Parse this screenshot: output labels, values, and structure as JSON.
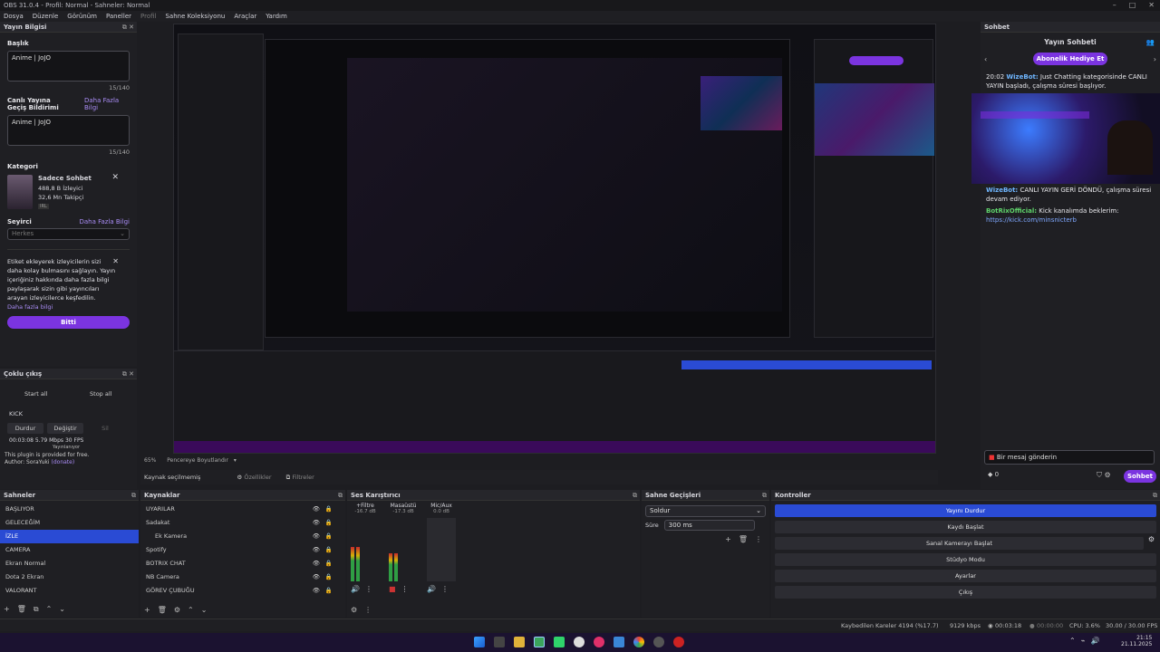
{
  "window": {
    "title": "OBS 31.0.4 - Profil: Normal - Sahneler: Normal",
    "controls": [
      "–",
      "□",
      "✕"
    ]
  },
  "menu": {
    "items": [
      "Dosya",
      "Düzenle",
      "Görünüm",
      "Paneller",
      "Profil",
      "Sahne Koleksiyonu",
      "Araçlar",
      "Yardım"
    ]
  },
  "stream_info": {
    "dock_title": "Yayın Bilgisi",
    "title_label": "Başlık",
    "title_value": "Anime | JoJO",
    "title_count": "15/140",
    "notif_label": "Canlı Yayına Geçiş Bildirimi",
    "more_info": "Daha Fazla Bilgi",
    "notif_value": "Anime | JoJO",
    "notif_count": "15/140",
    "category_label": "Kategori",
    "category_name": "Sadece Sohbet",
    "category_viewers": "488,8 B İzleyici",
    "category_followers": "32,6 Mn Takipçi",
    "category_tag": "IRL",
    "audience_label": "Seyirci",
    "audience_more": "Daha Fazla Bilgi",
    "audience_value": "Herkes",
    "tags_text": "Etiket ekleyerek izleyicilerin sizi daha kolay bulmasını sağlayın. Yayın içeriğiniz hakkında daha fazla bilgi paylaşarak sizin gibi yayıncıları arayan izleyicilerce keşfedilin.",
    "tags_more": "Daha fazla bilgi",
    "done_button": "Bitti"
  },
  "multi_stream": {
    "dock_title": "Çoklu çıkış",
    "start_all": "Start all",
    "stop_all": "Stop all",
    "target": "KICK",
    "stop": "Durdur",
    "edit": "Değiştir",
    "delete": "Sil",
    "stats": "00:03:08  5.79 Mbps  30 FPS",
    "status": "Yayınlanıyor",
    "plugin_note": "This plugin is provided for free.",
    "author": "Author: SoraYuki",
    "author_link": "(donate)"
  },
  "chat": {
    "dock_title": "Sohbet",
    "header": "Yayın Sohbeti",
    "gift_button": "Abonelik Hediye Et",
    "messages": [
      {
        "time": "20:02",
        "name": "WizeBot:",
        "text": "Just Chatting kategorisinde CANLI YAYIN başladı, çalışma süresi başlıyor."
      },
      {
        "time": "",
        "name": "",
        "text": "süresi devam ediyor."
      },
      {
        "time": "",
        "name": "WizeBot:",
        "text": "CANLI YAYIN GERİ DÖNDÜ, çalışma süresi devam ediyor."
      },
      {
        "time": "",
        "name": "BotRixOfficial:",
        "text": "Kick kanalımda beklerim:"
      },
      {
        "time": "",
        "name": "",
        "text": "https://kick.com/minsnicterb"
      }
    ],
    "input_placeholder": "Bir mesaj gönderin",
    "points": "0",
    "send_button": "Sohbet"
  },
  "preview_bar": {
    "zoom": "65%",
    "fit": "Pencereye Boyutlandır"
  },
  "source_bar": {
    "no_source": "Kaynak seçilmemiş",
    "properties": "Özellikler",
    "filters": "Filtreler"
  },
  "scenes": {
    "dock_title": "Sahneler",
    "items": [
      "BAŞLIYOR",
      "GELECEĞİM",
      "İZLE",
      "CAMERA",
      "Ekran Normal",
      "Dota 2 Ekran",
      "VALORANT"
    ],
    "selected_index": 2
  },
  "sources": {
    "dock_title": "Kaynaklar",
    "items": [
      "UYARILAR",
      "Sadakat",
      "Ek Kamera",
      "Spotify",
      "BOTRIX CHAT",
      "NB Camera",
      "GÖREV ÇUBUĞU"
    ]
  },
  "mixer": {
    "dock_title": "Ses Karıştırıcı",
    "channels": [
      {
        "name": "+Filtre",
        "db": "-16.7 dB"
      },
      {
        "name": "Masaüstü",
        "db": "-17.3 dB"
      },
      {
        "name": "Mic/Aux",
        "db": "0.0 dB"
      }
    ],
    "levels": [
      0.55,
      0.45,
      0.0
    ]
  },
  "transitions": {
    "dock_title": "Sahne Geçişleri",
    "type": "Soldur",
    "duration_label": "Süre",
    "duration_value": "300 ms"
  },
  "controls": {
    "dock_title": "Kontroller",
    "buttons": [
      "Yayını Durdur",
      "Kaydı Başlat",
      "Sanal Kamerayı Başlat",
      "Stüdyo Modu",
      "Ayarlar",
      "Çıkış"
    ],
    "active_index": 0
  },
  "status": {
    "dropped": "Kaybedilen Kareler 4194 (%17.7)",
    "bitrate": "9129 kbps",
    "stream_time": "00:03:18",
    "rec_time": "00:00:00",
    "cpu": "CPU: 3.6%",
    "fps": "30.00 / 30.00 FPS"
  },
  "clock": {
    "time": "21:15",
    "date": "21.11.2025"
  },
  "colors": {
    "accent": "#7b34e0",
    "selection": "#2a4bd4",
    "bg": "#1d1d21"
  }
}
